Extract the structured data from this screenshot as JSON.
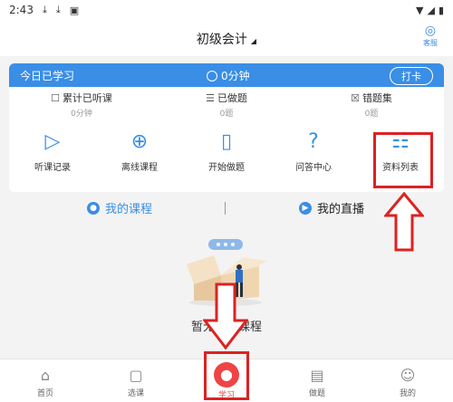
{
  "status_bar": {
    "time": "2:43",
    "icons": [
      "download-icon",
      "download-icon",
      "gallery-icon"
    ],
    "right_icons": [
      "wifi-icon",
      "signal-icon",
      "battery-icon"
    ]
  },
  "header": {
    "title": "初级会计",
    "service_label": "客服"
  },
  "today": {
    "label": "今日已学习",
    "duration": "0分钟",
    "checkin": "打卡"
  },
  "stats": [
    {
      "label": "累计已听课",
      "value": "0分钟",
      "icon": "listen-icon"
    },
    {
      "label": "已做题",
      "value": "0题",
      "icon": "doc-icon"
    },
    {
      "label": "错题集",
      "value": "0题",
      "icon": "wrong-icon"
    }
  ],
  "tools": [
    {
      "label": "听课记录",
      "icon": "play-record-icon"
    },
    {
      "label": "离线课程",
      "icon": "download-circle-icon"
    },
    {
      "label": "开始做题",
      "icon": "exam-book-icon"
    },
    {
      "label": "问答中心",
      "icon": "question-icon"
    },
    {
      "label": "资料列表",
      "icon": "clipboard-list-icon"
    }
  ],
  "course_tabs": {
    "my_courses": "我的课程",
    "my_live": "我的直播",
    "separator": "|"
  },
  "empty": {
    "text": "暂无已购课程"
  },
  "tabbar": [
    {
      "label": "首页",
      "icon": "home-icon",
      "active": false
    },
    {
      "label": "选课",
      "icon": "cart-icon",
      "active": false
    },
    {
      "label": "学习",
      "icon": "study-icon",
      "active": true
    },
    {
      "label": "做题",
      "icon": "practice-icon",
      "active": false
    },
    {
      "label": "我的",
      "icon": "profile-icon",
      "active": false
    }
  ],
  "colors": {
    "accent": "#3a8ee6",
    "highlight": "#d22222",
    "active_tab": "#ee4444"
  }
}
